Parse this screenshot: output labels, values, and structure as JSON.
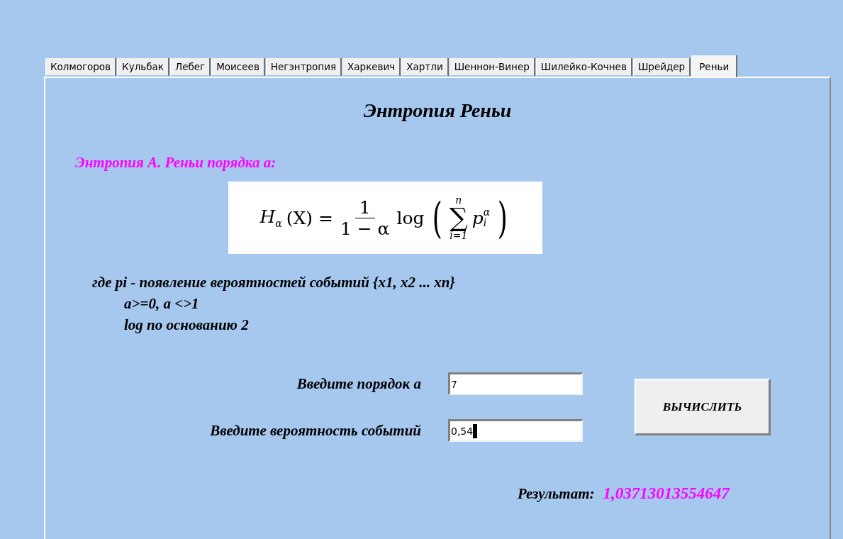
{
  "tabs": [
    {
      "label": "Колмогоров",
      "selected": false
    },
    {
      "label": "Кульбак",
      "selected": false
    },
    {
      "label": "Лебег",
      "selected": false
    },
    {
      "label": "Моисеев",
      "selected": false
    },
    {
      "label": "Негэнтропия",
      "selected": false
    },
    {
      "label": "Харкевич",
      "selected": false
    },
    {
      "label": "Хартли",
      "selected": false
    },
    {
      "label": "Шеннон-Винер",
      "selected": false
    },
    {
      "label": "Шилейко-Кочнев",
      "selected": false
    },
    {
      "label": "Шрейдер",
      "selected": false
    },
    {
      "label": "Реньи",
      "selected": true
    }
  ],
  "title": "Энтропия Реньи",
  "subtitle": "Энтропия А. Реньи порядка а:",
  "formula": {
    "lhs": "H",
    "lhs_sub": "α",
    "lhs_rest": "(X) =",
    "numerator": "1",
    "denominator": "1 − α",
    "log": "log",
    "sum_upper": "n",
    "sum_lower": "i=1",
    "sum": "∑",
    "term": "p",
    "term_sup": "α",
    "term_sub": "i",
    "open": "(",
    "close": ")"
  },
  "notes": [
    {
      "text": "где pi - появление вероятностей событий {x1, x2 ... xn}",
      "indented": false
    },
    {
      "text": "a>=0, a <>1",
      "indented": true
    },
    {
      "text": "log по основанию 2",
      "indented": true
    }
  ],
  "fields": [
    {
      "label": "Введите порядок а",
      "value": "7",
      "focused": false
    },
    {
      "label": "Введите вероятность событий",
      "value": "0,54",
      "focused": true
    }
  ],
  "button": "ВЫЧИСЛИТЬ",
  "result": {
    "label": "Результат:",
    "value": "1,03713013554647"
  }
}
